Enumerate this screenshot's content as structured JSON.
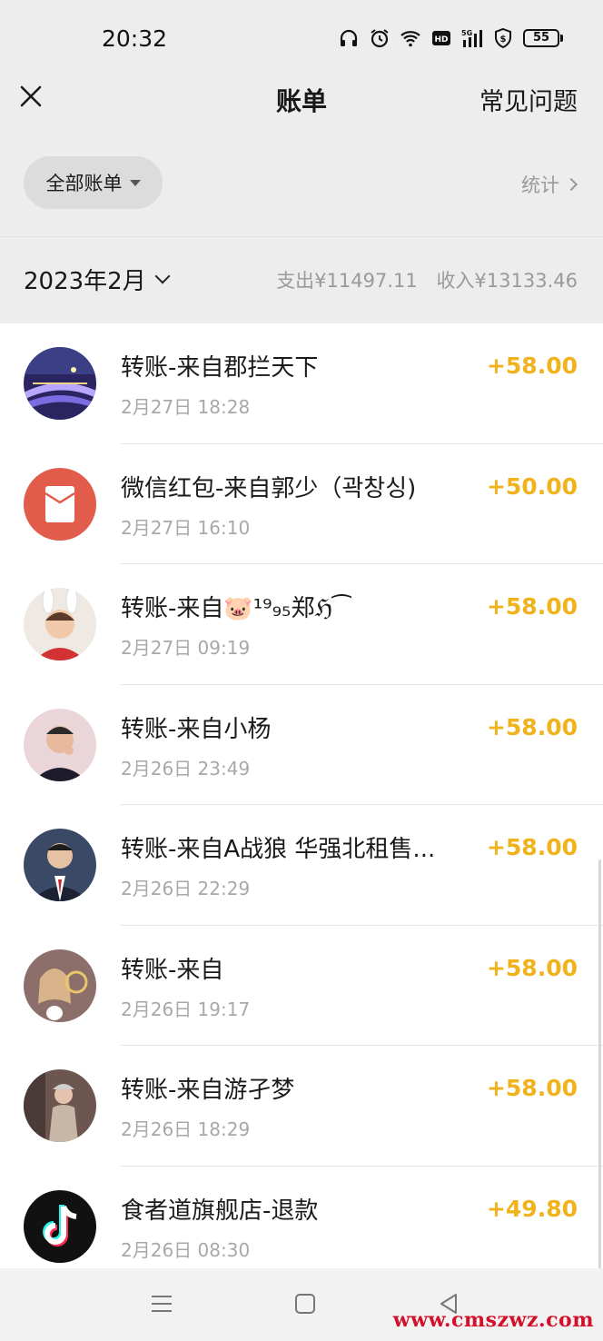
{
  "status": {
    "time": "20:32",
    "battery": "55"
  },
  "nav": {
    "title": "账单",
    "right_label": "常见问题"
  },
  "filter": {
    "label": "全部账单",
    "stats_label": "统计"
  },
  "month": {
    "label": "2023年2月",
    "expense": "支出¥11497.11",
    "income": "收入¥13133.46"
  },
  "transactions": [
    {
      "title": "转账-来自郡拦天下",
      "date": "2月27日 18:28",
      "amount": "+58.00"
    },
    {
      "title": "微信红包-来自郭少（곽창싱)",
      "date": "2月27日 16:10",
      "amount": "+50.00"
    },
    {
      "title": "转账-来自🐷¹⁹₉₅郑ℌ⁀",
      "date": "2月27日 09:19",
      "amount": "+58.00"
    },
    {
      "title": "转账-来自小杨",
      "date": "2月26日 23:49",
      "amount": "+58.00"
    },
    {
      "title": "转账-来自A战狼 华强北租售...",
      "date": "2月26日 22:29",
      "amount": "+58.00"
    },
    {
      "title": "转账-来自",
      "date": "2月26日 19:17",
      "amount": "+58.00"
    },
    {
      "title": "转账-来自游孑梦",
      "date": "2月26日 18:29",
      "amount": "+58.00"
    },
    {
      "title": "食者道旗舰店-退款",
      "date": "2月26日 08:30",
      "amount": "+49.80"
    }
  ],
  "watermark": "www.cmszwz.com",
  "colors": {
    "amount": "#f0b31c",
    "redpacket": "#e25c4c",
    "background": "#ededed"
  }
}
